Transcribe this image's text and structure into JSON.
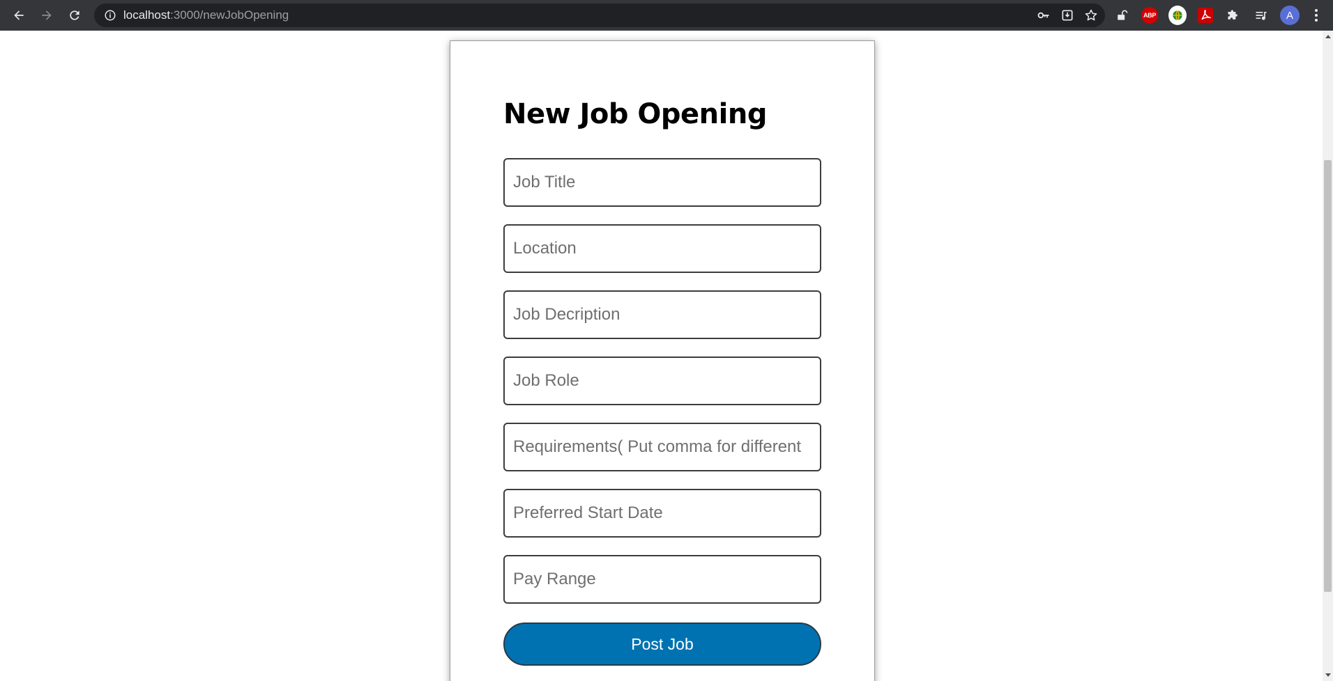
{
  "browser": {
    "url_host": "localhost",
    "url_path": ":3000/newJobOpening",
    "profile_initial": "A",
    "extensions": {
      "adblock_label": "ABP"
    }
  },
  "form": {
    "title": "New Job Opening",
    "fields": [
      {
        "placeholder": "Job Title",
        "value": ""
      },
      {
        "placeholder": "Location",
        "value": ""
      },
      {
        "placeholder": "Job Decription",
        "value": ""
      },
      {
        "placeholder": "Job Role",
        "value": ""
      },
      {
        "placeholder": "Requirements( Put comma for different",
        "value": ""
      },
      {
        "placeholder": "Preferred Start Date",
        "value": ""
      },
      {
        "placeholder": "Pay Range",
        "value": ""
      }
    ],
    "submit_label": "Post Job"
  },
  "colors": {
    "accent": "#0072b1",
    "chrome_bg": "#35363a",
    "omnibox_bg": "#202124"
  }
}
